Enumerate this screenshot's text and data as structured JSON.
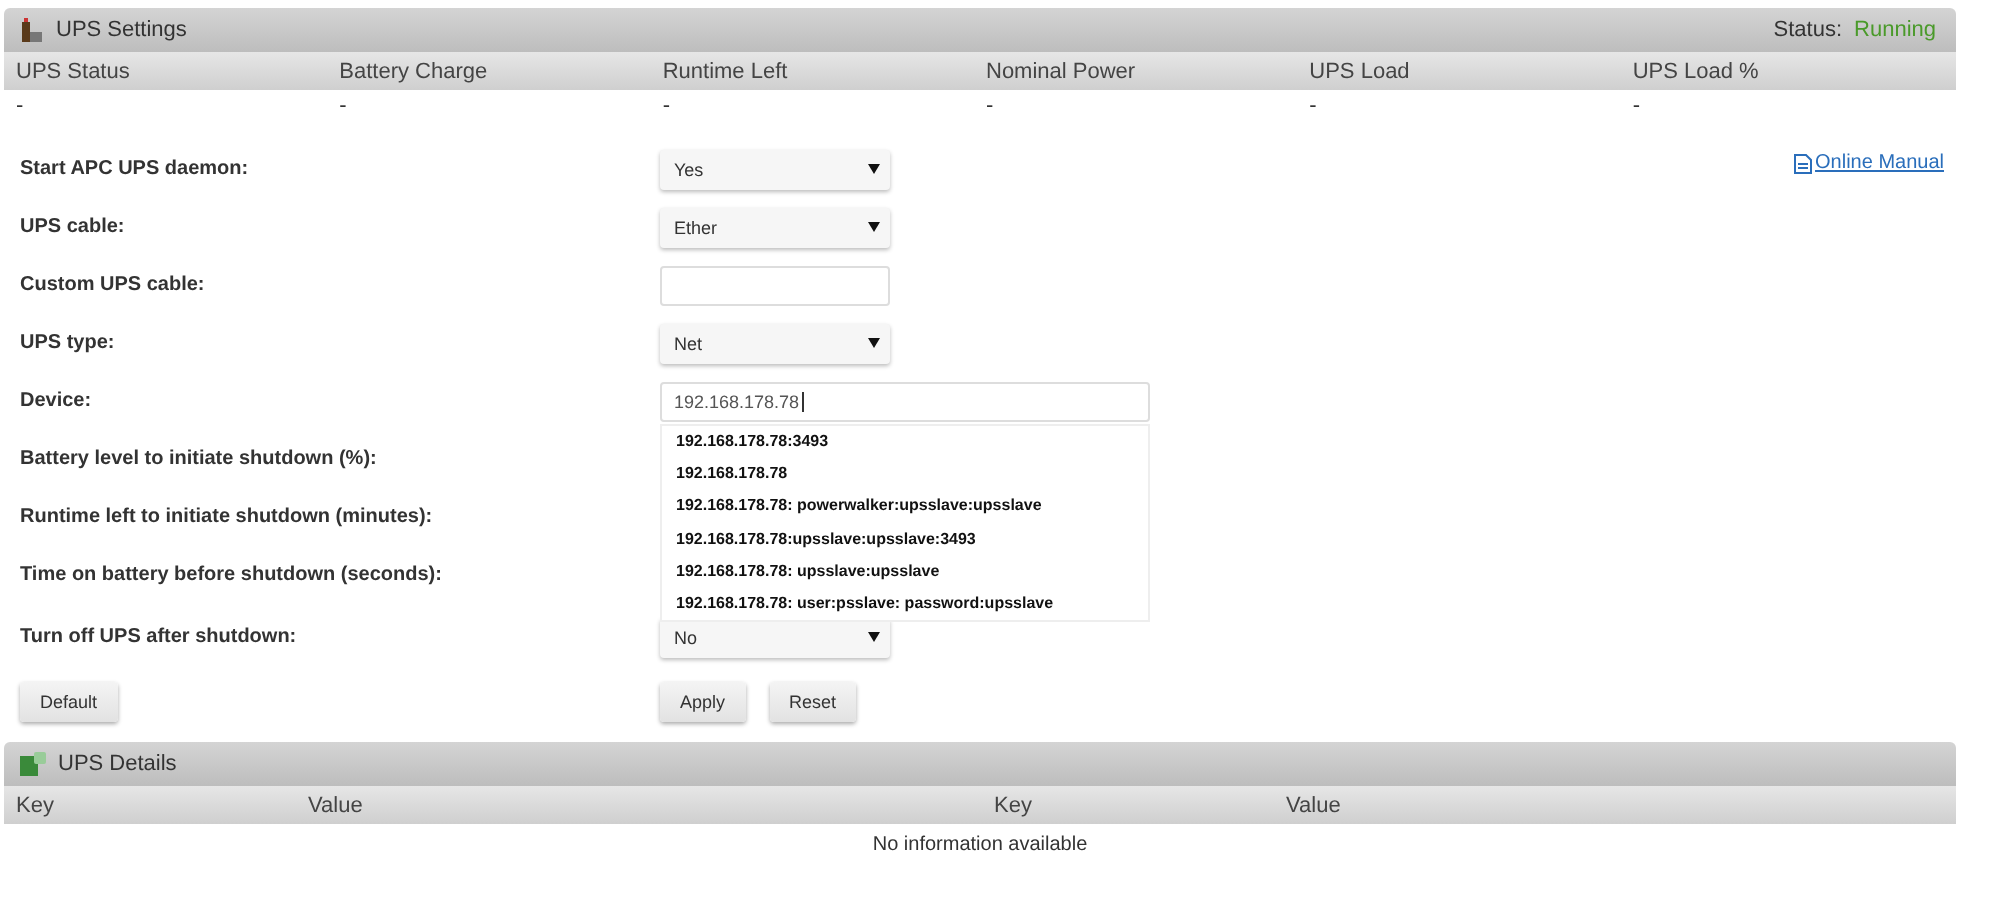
{
  "settings_panel": {
    "title": "UPS Settings",
    "status_label": "Status:",
    "status_value": "Running",
    "columns": [
      "UPS Status",
      "Battery Charge",
      "Runtime Left",
      "Nominal Power",
      "UPS Load",
      "UPS Load %"
    ],
    "values": [
      "-",
      "-",
      "-",
      "-",
      "-",
      "-"
    ]
  },
  "manual_link": "Online Manual",
  "form_rows": [
    {
      "label": "Start APC UPS daemon:",
      "kind": "select",
      "value": "Yes"
    },
    {
      "label": "UPS cable:",
      "kind": "select",
      "value": "Ether"
    },
    {
      "label": "Custom UPS cable:",
      "kind": "input"
    },
    {
      "label": "UPS type:",
      "kind": "select",
      "value": "Net"
    },
    {
      "label": "Device:",
      "kind": "combo",
      "value": "192.168.178.78",
      "suggestions": [
        "192.168.178.78:3493",
        "192.168.178.78",
        "192.168.178.78: powerwalker:upsslave:upsslave",
        "192.168.178.78:upsslave:upsslave:3493",
        "192.168.178.78: upsslave:upsslave",
        "192.168.178.78: user:psslave: password:upsslave"
      ]
    },
    {
      "label": "Battery level to initiate shutdown (%):",
      "kind": "hidden"
    },
    {
      "label": "Runtime left to initiate shutdown (minutes):",
      "kind": "hidden"
    },
    {
      "label": "Time on battery before shutdown (seconds):",
      "kind": "hidden"
    },
    {
      "label": "Turn off UPS after shutdown:",
      "kind": "select",
      "value": "No"
    }
  ],
  "buttons": {
    "left": [
      "Default"
    ],
    "right": [
      "Apply",
      "Reset"
    ]
  },
  "details_panel": {
    "title": "UPS Details",
    "columns": [
      "Key",
      "Value",
      "Key",
      "Value"
    ],
    "empty_text": "No information available"
  }
}
